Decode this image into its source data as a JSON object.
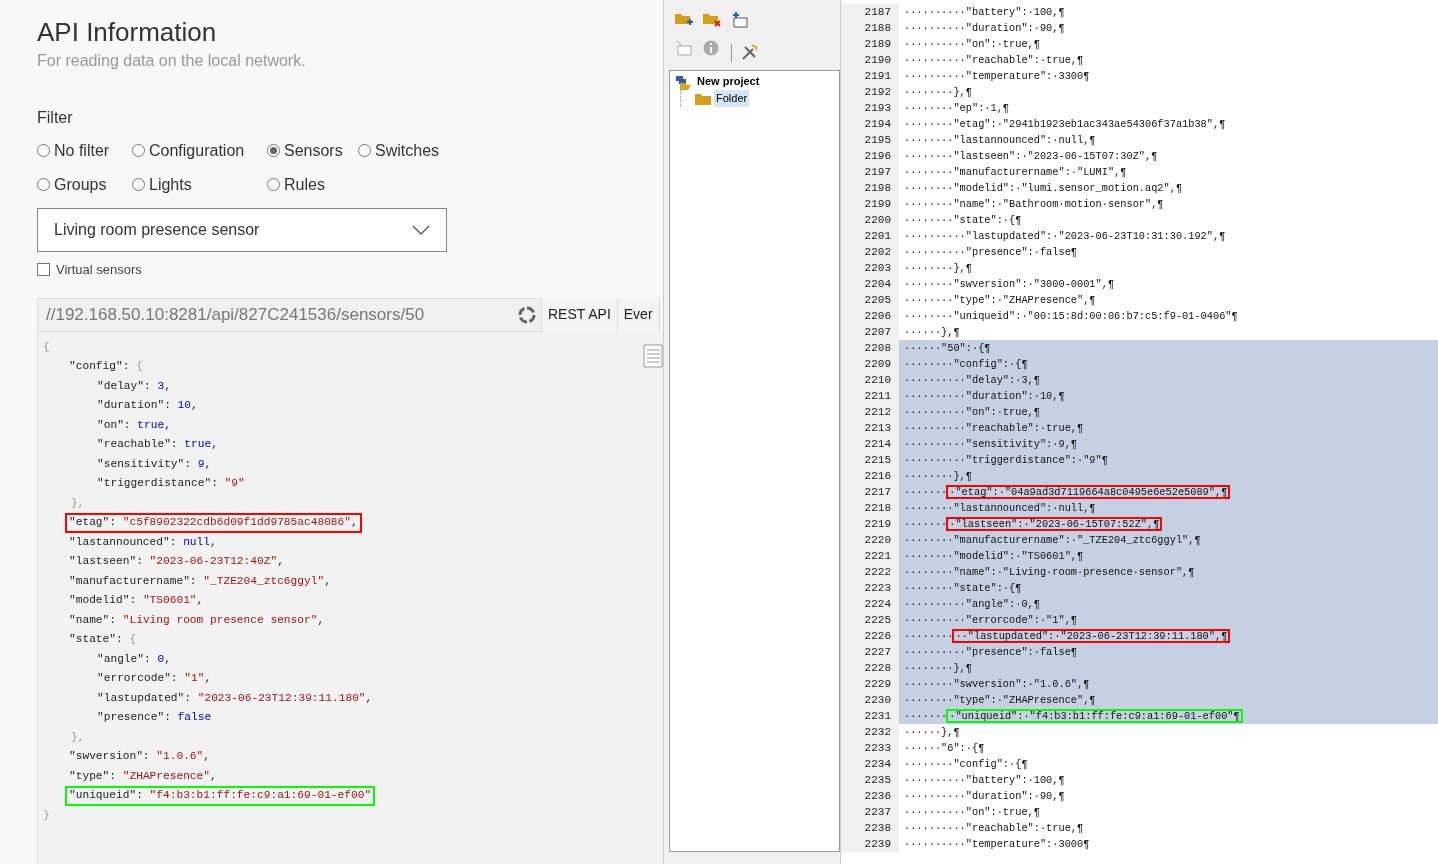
{
  "api_info": {
    "title": "API Information",
    "subtitle": "For reading data on the local network.",
    "filter": {
      "label": "Filter",
      "options": [
        {
          "label": "No filter",
          "selected": false
        },
        {
          "label": "Configuration",
          "selected": false
        },
        {
          "label": "Sensors",
          "selected": true
        },
        {
          "label": "Switches",
          "selected": false
        },
        {
          "label": "Groups",
          "selected": false
        },
        {
          "label": "Lights",
          "selected": false
        },
        {
          "label": "Rules",
          "selected": false
        }
      ]
    },
    "device_select": {
      "value": "Living room presence sensor"
    },
    "virtual_sensors": {
      "label": "Virtual sensors",
      "checked": false
    },
    "url": "//192.168.50.10:8281/api/827C241536/sensors/50",
    "tabs": [
      {
        "label": "REST API"
      },
      {
        "label": "Ever"
      }
    ],
    "json_view": {
      "open": "{",
      "close": "}",
      "children": [
        {
          "key": "\"config\"",
          "sep": ": ",
          "value": "{",
          "kind": "brace",
          "close": "},",
          "children": [
            {
              "key": "\"delay\"",
              "sep": ": ",
              "value": "3",
              "kind": "number",
              "end": ","
            },
            {
              "key": "\"duration\"",
              "sep": ": ",
              "value": "10",
              "kind": "number",
              "end": ","
            },
            {
              "key": "\"on\"",
              "sep": ": ",
              "value": "true",
              "kind": "literal",
              "end": ","
            },
            {
              "key": "\"reachable\"",
              "sep": ": ",
              "value": "true",
              "kind": "literal",
              "end": ","
            },
            {
              "key": "\"sensitivity\"",
              "sep": ": ",
              "value": "9",
              "kind": "number",
              "end": ","
            },
            {
              "key": "\"triggerdistance\"",
              "sep": ": ",
              "value": "\"9\"",
              "kind": "string"
            }
          ]
        },
        {
          "key": "\"etag\"",
          "sep": ": ",
          "value": "\"c5f8902322cdb6d09f1dd9785ac48086\"",
          "kind": "string",
          "end": ",",
          "color": "#ff0000"
        },
        {
          "key": "\"lastannounced\"",
          "sep": ": ",
          "value": "null",
          "kind": "literal",
          "end": ","
        },
        {
          "key": "\"lastseen\"",
          "sep": ": ",
          "value": "\"2023-06-23T12:40Z\"",
          "kind": "string",
          "end": ","
        },
        {
          "key": "\"manufacturername\"",
          "sep": ": ",
          "value": "\"_TZE204_ztc6ggyl\"",
          "kind": "string",
          "end": ","
        },
        {
          "key": "\"modelid\"",
          "sep": ": ",
          "value": "\"TS0601\"",
          "kind": "string",
          "end": ","
        },
        {
          "key": "\"name\"",
          "sep": ": ",
          "value": "\"Living room presence sensor\"",
          "kind": "string",
          "end": ","
        },
        {
          "key": "\"state\"",
          "sep": ": ",
          "value": "{",
          "kind": "brace",
          "close": "},",
          "children": [
            {
              "key": "\"angle\"",
              "sep": ": ",
              "value": "0",
              "kind": "number",
              "end": ","
            },
            {
              "key": "\"errorcode\"",
              "sep": ": ",
              "value": "\"1\"",
              "kind": "string",
              "end": ","
            },
            {
              "key": "\"lastupdated\"",
              "sep": ": ",
              "value": "\"2023-06-23T12:39:11.180\"",
              "kind": "string",
              "end": ","
            },
            {
              "key": "\"presence\"",
              "sep": ": ",
              "value": "false",
              "kind": "literal"
            }
          ]
        },
        {
          "key": "\"swversion\"",
          "sep": ": ",
          "value": "\"1.0.6\"",
          "kind": "string",
          "end": ","
        },
        {
          "key": "\"type\"",
          "sep": ": ",
          "value": "\"ZHAPresence\"",
          "kind": "string",
          "end": ","
        },
        {
          "key": "\"uniqueid\"",
          "sep": ": ",
          "value": "\"f4:b3:b1:ff:fe:c9:a1:69-01-ef00\"",
          "kind": "string",
          "color": "#00ff00"
        }
      ]
    }
  },
  "project": {
    "tree": [
      {
        "label": "New project",
        "children": [
          {
            "label": "Folder",
            "selected": true
          }
        ]
      }
    ]
  },
  "editor": {
    "lines": [
      {
        "number": "2187",
        "text": "··········\"battery\":·100,¶",
        "selected": false
      },
      {
        "number": "2188",
        "text": "··········\"duration\":·90,¶",
        "selected": false
      },
      {
        "number": "2189",
        "text": "··········\"on\":·true,¶",
        "selected": false
      },
      {
        "number": "2190",
        "text": "··········\"reachable\":·true,¶",
        "selected": false
      },
      {
        "number": "2191",
        "text": "··········\"temperature\":·3300¶",
        "selected": false
      },
      {
        "number": "2192",
        "text": "········},¶",
        "selected": false
      },
      {
        "number": "2193",
        "text": "········\"ep\":·1,¶",
        "selected": false
      },
      {
        "number": "2194",
        "text": "········\"etag\":·\"2941b1923eb1ac343ae54306f37a1b38\",¶",
        "selected": false
      },
      {
        "number": "2195",
        "text": "········\"lastannounced\":·null,¶",
        "selected": false
      },
      {
        "number": "2196",
        "text": "········\"lastseen\":·\"2023-06-15T07:30Z\",¶",
        "selected": false
      },
      {
        "number": "2197",
        "text": "········\"manufacturername\":·\"LUMI\",¶",
        "selected": false
      },
      {
        "number": "2198",
        "text": "········\"modelid\":·\"lumi.sensor_motion.aq2\",¶",
        "selected": false
      },
      {
        "number": "2199",
        "text": "········\"name\":·\"Bathroom·motion·sensor\",¶",
        "selected": false
      },
      {
        "number": "2200",
        "text": "········\"state\":·{¶",
        "selected": false
      },
      {
        "number": "2201",
        "text": "··········\"lastupdated\":·\"2023-06-23T10:31:30.192\",¶",
        "selected": false
      },
      {
        "number": "2202",
        "text": "··········\"presence\":·false¶",
        "selected": false
      },
      {
        "number": "2203",
        "text": "········},¶",
        "selected": false
      },
      {
        "number": "2204",
        "text": "········\"swversion\":·\"3000-0001\",¶",
        "selected": false
      },
      {
        "number": "2205",
        "text": "········\"type\":·\"ZHAPresence\",¶",
        "selected": false
      },
      {
        "number": "2206",
        "text": "········\"uniqueid\":·\"00:15:8d:00:06:b7:c5:f9-01-0406\"¶",
        "selected": false
      },
      {
        "number": "2207",
        "text": "······},¶",
        "selected": false
      },
      {
        "number": "2208",
        "text": "······\"50\":·{¶",
        "selected": true
      },
      {
        "number": "2209",
        "text": "········\"config\":·{¶",
        "selected": true
      },
      {
        "number": "2210",
        "text": "··········\"delay\":·3,¶",
        "selected": true
      },
      {
        "number": "2211",
        "text": "··········\"duration\":·10,¶",
        "selected": true
      },
      {
        "number": "2212",
        "text": "··········\"on\":·true,¶",
        "selected": true
      },
      {
        "number": "2213",
        "text": "··········\"reachable\":·true,¶",
        "selected": true
      },
      {
        "number": "2214",
        "text": "··········\"sensitivity\":·9,¶",
        "selected": true
      },
      {
        "number": "2215",
        "text": "··········\"triggerdistance\":·\"9\"¶",
        "selected": true
      },
      {
        "number": "2216",
        "text": "········},¶",
        "selected": true
      },
      {
        "number": "2217",
        "text": "·······",
        "boxed": "·\"etag\":·\"04a9ad3d7119664a8c0495e6e52e5089\",¶",
        "color": "#ff0000",
        "selected": true
      },
      {
        "number": "2218",
        "text": "········\"lastannounced\":·null,¶",
        "selected": true
      },
      {
        "number": "2219",
        "text": "·······",
        "boxed": "·\"lastseen\":·\"2023-06-15T07:52Z\",¶",
        "color": "#ff0000",
        "selected": true
      },
      {
        "number": "2220",
        "text": "········\"manufacturername\":·\"_TZE204_ztc6ggyl\",¶",
        "selected": true
      },
      {
        "number": "2221",
        "text": "········\"modelid\":·\"TS0601\",¶",
        "selected": true
      },
      {
        "number": "2222",
        "text": "········\"name\":·\"Living·room·presence·sensor\",¶",
        "selected": true
      },
      {
        "number": "2223",
        "text": "········\"state\":·{¶",
        "selected": true
      },
      {
        "number": "2224",
        "text": "··········\"angle\":·0,¶",
        "selected": true
      },
      {
        "number": "2225",
        "text": "··········\"errorcode\":·\"1\",¶",
        "selected": true
      },
      {
        "number": "2226",
        "text": "········",
        "boxed": "··\"lastupdated\":·\"2023-06-23T12:39:11.180\",¶",
        "color": "#ff0000",
        "selected": true
      },
      {
        "number": "2227",
        "text": "··········\"presence\":·false¶",
        "selected": true
      },
      {
        "number": "2228",
        "text": "········},¶",
        "selected": true
      },
      {
        "number": "2229",
        "text": "········\"swversion\":·\"1.0.6\",¶",
        "selected": true
      },
      {
        "number": "2230",
        "text": "········\"type\":·\"ZHAPresence\",¶",
        "selected": true
      },
      {
        "number": "2231",
        "text": "·······",
        "boxed": "·\"uniqueid\":·\"f4:b3:b1:ff:fe:c9:a1:69-01-ef00\"¶",
        "color": "#00ff00",
        "selected": true
      },
      {
        "number": "2232",
        "text": "······},¶",
        "selected": false
      },
      {
        "number": "2233",
        "text": "······\"6\":·{¶",
        "selected": false
      },
      {
        "number": "2234",
        "text": "········\"config\":·{¶",
        "selected": false
      },
      {
        "number": "2235",
        "text": "··········\"battery\":·100,¶",
        "selected": false
      },
      {
        "number": "2236",
        "text": "··········\"duration\":·90,¶",
        "selected": false
      },
      {
        "number": "2237",
        "text": "··········\"on\":·true,¶",
        "selected": false
      },
      {
        "number": "2238",
        "text": "··········\"reachable\":·true,¶",
        "selected": false
      },
      {
        "number": "2239",
        "text": "··········\"temperature\":·3000¶",
        "selected": false
      }
    ]
  }
}
